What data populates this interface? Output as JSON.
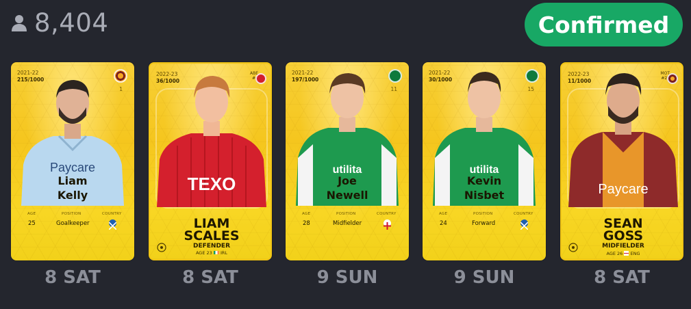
{
  "header": {
    "user_count": "8,404",
    "status_button": "Confirmed"
  },
  "stat_labels": {
    "age": "AGE",
    "position": "POSITION",
    "country": "COUNTRY"
  },
  "cards": [
    {
      "season": "2021-22",
      "serial": "215/1000",
      "shirt": "1",
      "first": "Liam",
      "last": "Kelly",
      "age": "25",
      "position": "Goalkeeper",
      "flag": "scotland",
      "day": "8 SAT"
    },
    {
      "season": "2022-23",
      "serial": "36/1000",
      "club_code": "ABE",
      "shirt": "#4",
      "first": "LIAM",
      "last": "SCALES",
      "position": "DEFENDER",
      "age_line": "AGE 23",
      "nation": "IRL",
      "flag": "ireland",
      "day": "8 SAT"
    },
    {
      "season": "2021-22",
      "serial": "197/1000",
      "shirt": "11",
      "first": "Joe",
      "last": "Newell",
      "age": "28",
      "position": "Midfielder",
      "flag": "england",
      "day": "9 SUN"
    },
    {
      "season": "2021-22",
      "serial": "30/1000",
      "shirt": "15",
      "first": "Kevin",
      "last": "Nisbet",
      "age": "24",
      "position": "Forward",
      "flag": "scotland",
      "day": "9 SUN"
    },
    {
      "season": "2022-23",
      "serial": "11/1000",
      "club_code": "MOT",
      "shirt": "#27",
      "first": "SEAN",
      "last": "GOSS",
      "position": "MIDFIELDER",
      "age_line": "AGE 26",
      "nation": "ENG",
      "flag": "england",
      "day": "8 SAT"
    }
  ],
  "colors": {
    "background": "#24262e",
    "confirmed_green": "#18a865",
    "card_gold": "#f5c61e",
    "day_text": "#8c8f99"
  },
  "icons": [
    "user-icon",
    "club-crest-icon",
    "flag-icon",
    "football-icon"
  ]
}
